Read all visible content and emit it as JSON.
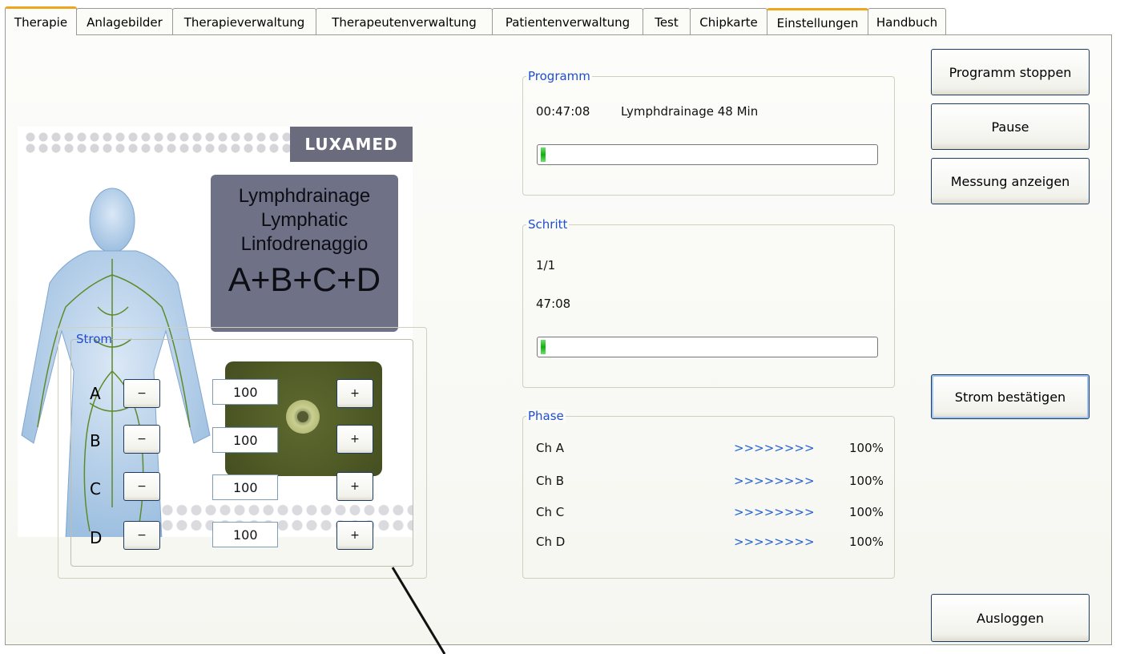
{
  "tabs": [
    "Therapie",
    "Anlagebilder",
    "Therapieverwaltung",
    "Therapeutenverwaltung",
    "Patientenverwaltung",
    "Test",
    "Chipkarte",
    "Einstellungen",
    "Handbuch"
  ],
  "image": {
    "brand": "LUXAMED",
    "names": [
      "Lymphdrainage",
      "Lymphatic",
      "Linfodrenaggio"
    ],
    "electrodes": "A+B+C+D"
  },
  "programm": {
    "legend": "Programm",
    "time": "00:47:08",
    "name": "Lymphdrainage 48 Min",
    "progress_percent": 1
  },
  "schritt": {
    "legend": "Schritt",
    "step": "1/1",
    "time": "47:08",
    "progress_percent": 1
  },
  "phase": {
    "legend": "Phase",
    "channels": [
      {
        "label": "Ch A",
        "arrows": ">>>>>>>>",
        "percent": "100%"
      },
      {
        "label": "Ch B",
        "arrows": ">>>>>>>>",
        "percent": "100%"
      },
      {
        "label": "Ch C",
        "arrows": ">>>>>>>>",
        "percent": "100%"
      },
      {
        "label": "Ch D",
        "arrows": ">>>>>>>>",
        "percent": "100%"
      }
    ]
  },
  "strom": {
    "legend": "Strom",
    "minus": "−",
    "plus": "+",
    "channels": [
      {
        "label": "A",
        "value": "100"
      },
      {
        "label": "B",
        "value": "100"
      },
      {
        "label": "C",
        "value": "100"
      },
      {
        "label": "D",
        "value": "100"
      }
    ]
  },
  "buttons": {
    "stop": "Programm stoppen",
    "pause": "Pause",
    "messung": "Messung anzeigen",
    "strom": "Strom bestätigen",
    "logout": "Ausloggen"
  }
}
